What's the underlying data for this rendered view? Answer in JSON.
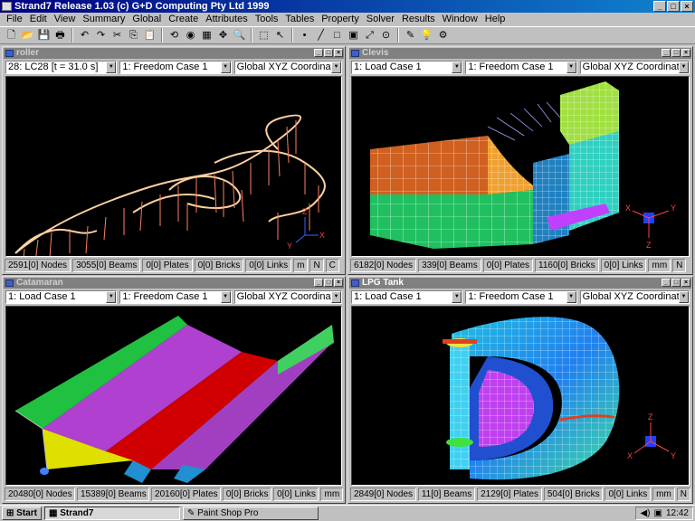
{
  "app": {
    "title": "Strand7 Release 1.03 (c) G+D Computing Pty Ltd 1999",
    "window_buttons": [
      "_",
      "□",
      "×"
    ]
  },
  "menu": [
    "File",
    "Edit",
    "View",
    "Summary",
    "Global",
    "Create",
    "Attributes",
    "Tools",
    "Tables",
    "Property",
    "Solver",
    "Results",
    "Window",
    "Help"
  ],
  "toolbar": {
    "buttons": [
      "new-icon",
      "open-icon",
      "save-icon",
      "print-icon",
      "undo-icon",
      "redo-icon",
      "cut-icon",
      "copy-icon",
      "paste-icon",
      "rotate-icon",
      "refresh-icon",
      "zoom-window-icon",
      "pan-icon",
      "zoom-icon",
      "select-icon",
      "pointer-icon",
      "node-icon",
      "beam-icon",
      "plate-icon",
      "brick-icon",
      "link-icon",
      "cylinder-icon",
      "colour-icon",
      "bulb-icon",
      "settings-icon"
    ],
    "glyphs": [
      "🗋",
      "📂",
      "💾",
      "🖶",
      "↶",
      "↷",
      "✂",
      "⎘",
      "📋",
      "⟲",
      "◉",
      "▦",
      "✥",
      "🔍",
      "⬚",
      "↖",
      "•",
      "╱",
      "□",
      "▣",
      "⤢",
      "⊙",
      "✎",
      "💡",
      "⚙"
    ]
  },
  "windows": [
    {
      "id": "roller",
      "title": "roller",
      "active": false,
      "selects": [
        "28:  LC28 [t = 31.0 s]",
        "1: Freedom Case 1",
        "Global XYZ Coordinate Sy"
      ],
      "status": [
        "2591[0] Nodes",
        "3055[0] Beams",
        "0[0] Plates",
        "0[0] Bricks",
        "0[0] Links",
        "m",
        "N",
        "C"
      ],
      "axis": [
        "X",
        "Y",
        "Z"
      ]
    },
    {
      "id": "clevis",
      "title": "Clevis",
      "active": false,
      "selects": [
        "1: Load Case 1",
        "1: Freedom Case 1",
        "Global XYZ Coordinate Sy"
      ],
      "status": [
        "6182[0] Nodes",
        "339[0] Beams",
        "0[0] Plates",
        "1160[0] Bricks",
        "0[0] Links",
        "mm",
        "N"
      ],
      "axis": [
        "X",
        "Y",
        "Z"
      ]
    },
    {
      "id": "catamaran",
      "title": "Catamaran",
      "active": false,
      "selects": [
        "1: Load Case 1",
        "1: Freedom Case 1",
        "Global XYZ Coordinate Sy"
      ],
      "status": [
        "20480[0] Nodes",
        "15389[0] Beams",
        "20160[0] Plates",
        "0[0] Bricks",
        "0[0] Links",
        "mm"
      ],
      "axis": []
    },
    {
      "id": "lpg",
      "title": "LPG Tank",
      "active": true,
      "selects": [
        "1: Load Case 1",
        "1: Freedom Case 1",
        "Global XYZ Coordinate Sy"
      ],
      "status": [
        "2849[0] Nodes",
        "11[0] Beams",
        "2129[0] Plates",
        "504[0] Bricks",
        "0[0] Links",
        "mm",
        "N"
      ],
      "axis": [
        "X",
        "Y",
        "Z"
      ]
    }
  ],
  "taskbar": {
    "start": "Start",
    "tasks": [
      "Strand7",
      "Paint Shop Pro"
    ],
    "clock": "12:42"
  },
  "colors": {
    "titlebar": "#000080",
    "viewport": "#000000",
    "face": "#c0c0c0"
  }
}
